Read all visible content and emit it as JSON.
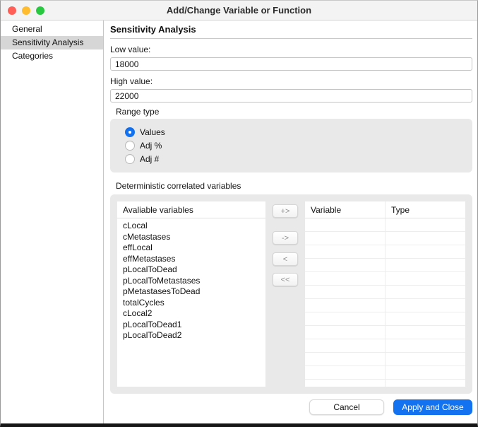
{
  "window": {
    "title": "Add/Change Variable or Function"
  },
  "sidebar": {
    "items": [
      {
        "label": "General",
        "selected": false
      },
      {
        "label": "Sensitivity Analysis",
        "selected": true
      },
      {
        "label": "Categories",
        "selected": false
      }
    ]
  },
  "main": {
    "heading": "Sensitivity Analysis",
    "fields": [
      {
        "label": "Low value:",
        "value": "18000"
      },
      {
        "label": "High value:",
        "value": "22000"
      }
    ],
    "range_type": {
      "label": "Range type",
      "options": [
        {
          "label": "Values",
          "selected": true
        },
        {
          "label": "Adj %",
          "selected": false
        },
        {
          "label": "Adj #",
          "selected": false
        }
      ]
    },
    "correlated": {
      "label": "Deterministic correlated variables",
      "available_header": "Avaliable variables",
      "available_items": [
        "cLocal",
        "cMetastases",
        "effLocal",
        "effMetastases",
        "pLocalToDead",
        "pLocalToMetastases",
        "pMetastasesToDead",
        "totalCycles",
        "cLocal2",
        "pLocalToDead1",
        "pLocalToDead2"
      ],
      "transfer_buttons": [
        "+>",
        "->",
        "<",
        "<<"
      ],
      "table": {
        "columns": [
          "Variable",
          "Type"
        ],
        "rows": []
      }
    }
  },
  "footer": {
    "cancel_label": "Cancel",
    "apply_label": "Apply and Close"
  },
  "colors": {
    "accent_blue": "#1372f0",
    "panel_gray": "#e9e9e9",
    "sidebar_selected": "#d6d6d6",
    "traffic_red": "#ff5f57",
    "traffic_yellow": "#febc2e",
    "traffic_green": "#28c840"
  }
}
